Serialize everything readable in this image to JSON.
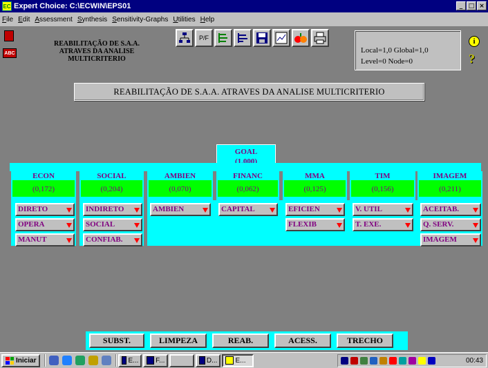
{
  "window": {
    "title": "Expert Choice: C:\\ECWIN\\EPS01",
    "app_icon": "ec-app-icon",
    "controls": [
      "_",
      "□",
      "×"
    ]
  },
  "menu": {
    "items": [
      "File",
      "Edit",
      "Assessment",
      "Synthesis",
      "Sensitivity-Graphs",
      "Utilities",
      "Help"
    ]
  },
  "toolbar": {
    "goal_lines": [
      "REABILITAÇÃO DE S.A.A.",
      "ATRAVES DA ANALISE",
      "MULTICRITERIO"
    ],
    "abc_label": "ABC",
    "pf_label": "P/F",
    "buttons": [
      "hierarchy-icon",
      "pf-icon",
      "tree-left-icon",
      "tree-right-icon",
      "save-icon",
      "graph-icon",
      "fruits-icon",
      "printer-icon"
    ]
  },
  "status": {
    "local_global": "Local=1,0 Global=1,0",
    "level_node": "Level=0  Node=0",
    "info_glyph": "i",
    "help_glyph": "?"
  },
  "banner": {
    "title": "REABILITAÇÃO DE S.A.A. ATRAVES DA ANALISE MULTICRITERIO"
  },
  "goal": {
    "name": "GOAL",
    "value": "(1,000)"
  },
  "criteria": [
    {
      "name": "ECON",
      "value": "(0,172)",
      "subs": [
        "DIRETO",
        "OPERA",
        "MANUT"
      ]
    },
    {
      "name": "SOCIAL",
      "value": "(0,204)",
      "subs": [
        "INDIRETO",
        "SOCIAL",
        "CONFIAB."
      ]
    },
    {
      "name": "AMBIEN",
      "value": "(0,070)",
      "subs": [
        "AMBIEN"
      ]
    },
    {
      "name": "FINANC",
      "value": "(0,062)",
      "subs": [
        "CAPITAL"
      ]
    },
    {
      "name": "MMA",
      "value": "(0,125)",
      "subs": [
        "EFICIEN",
        "FLEXIB"
      ]
    },
    {
      "name": "TIM",
      "value": "(0,156)",
      "subs": [
        "V. UTIL",
        "T. EXE."
      ]
    },
    {
      "name": "IMAGEM",
      "value": "(0,211)",
      "subs": [
        "ACEITAB.",
        "Q. SERV.",
        "IMAGEM"
      ]
    }
  ],
  "alternatives": [
    "SUBST.",
    "LIMPEZA",
    "REAB.",
    "ACESS.",
    "TRECHO"
  ],
  "taskbar": {
    "start_label": "Iniciar",
    "tasks": [
      "E...",
      "F...",
      "",
      "D...",
      "E..."
    ],
    "clock": "00:43"
  },
  "colors": {
    "title_bar": "#000080",
    "node_bg": "#00ffff",
    "value_bg": "#00ff00",
    "node_text": "#800080",
    "arrow": "#ff0000"
  }
}
